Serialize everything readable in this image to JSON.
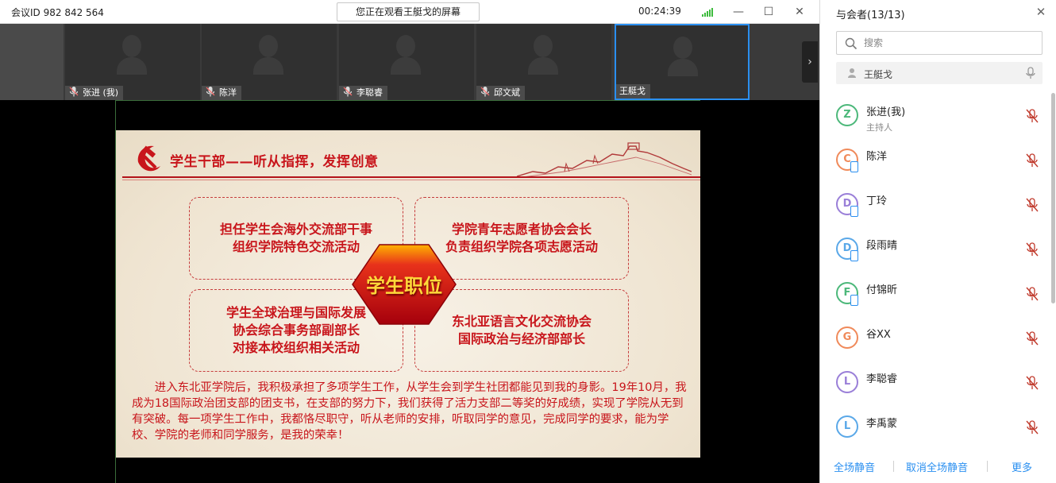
{
  "topbar": {
    "meeting_id": "会议ID 982 842 564",
    "viewing": "您正在观看王艇戈的屏幕",
    "timer": "00:24:39",
    "signal_color": "#3dbb3d",
    "window_buttons": [
      "minimize-icon",
      "maximize-icon",
      "close-icon"
    ]
  },
  "strip": {
    "tiles": [
      {
        "name": "张进 (我)",
        "mic": true
      },
      {
        "name": "陈洋",
        "mic": true
      },
      {
        "name": "李聪睿",
        "mic": true
      },
      {
        "name": "邱文斌",
        "mic": true
      },
      {
        "name": "王艇戈",
        "mic": false,
        "active": true
      }
    ],
    "next_icon": "›"
  },
  "slide": {
    "title": "学生干部——听从指挥，发挥创意",
    "boxes": [
      {
        "line1": "担任学生会海外交流部干事",
        "line2": "组织学院特色交流活动"
      },
      {
        "line1": "学院青年志愿者协会会长",
        "line2": "负责组织学院各项志愿活动"
      },
      {
        "line1": "学生全球治理与国际发展",
        "line2": "协会综合事务部副部长",
        "line3": "对接本校组织相关活动"
      },
      {
        "line1": "东北亚语言文化交流协会",
        "line2": "国际政治与经济部部长"
      }
    ],
    "center_label": "学生职位",
    "paragraph": "进入东北亚学院后，我积极承担了多项学生工作，从学生会到学生社团都能见到我的身影。19年10月，我成为18国际政治团支部的团支书，在支部的努力下，我们获得了活力支部二等奖的好成绩，实现了学院从无到有突破。每一项学生工作中，我都恪尽职守，听从老师的安排，听取同学的意见，完成同学的要求，能为学校、学院的老师和同学服务，是我的荣幸！",
    "accent_color": "#c8151b"
  },
  "panel": {
    "title": "与会者(13/13)",
    "search_placeholder": "搜索",
    "speaker": "王艇戈",
    "participants": [
      {
        "initial": "Z",
        "name": "张进(我)",
        "role": "主持人",
        "color": "#4cb87a",
        "device": false
      },
      {
        "initial": "C",
        "name": "陈洋",
        "role": "",
        "color": "#f08a5a",
        "device": true
      },
      {
        "initial": "D",
        "name": "丁玲",
        "role": "",
        "color": "#9a7fd8",
        "device": true
      },
      {
        "initial": "D",
        "name": "段雨晴",
        "role": "",
        "color": "#5aa8e8",
        "device": true
      },
      {
        "initial": "F",
        "name": "付锦昕",
        "role": "",
        "color": "#4cb87a",
        "device": true
      },
      {
        "initial": "G",
        "name": "谷XX",
        "role": "",
        "color": "#f08a5a",
        "device": false
      },
      {
        "initial": "L",
        "name": "李聪睿",
        "role": "",
        "color": "#9a7fd8",
        "device": false
      },
      {
        "initial": "L",
        "name": "李禹蒙",
        "role": "",
        "color": "#5aa8e8",
        "device": false
      }
    ],
    "footer": {
      "mute_all": "全场静音",
      "unmute_all": "取消全场静音",
      "more": "更多"
    },
    "link_color": "#2a8ff0"
  }
}
